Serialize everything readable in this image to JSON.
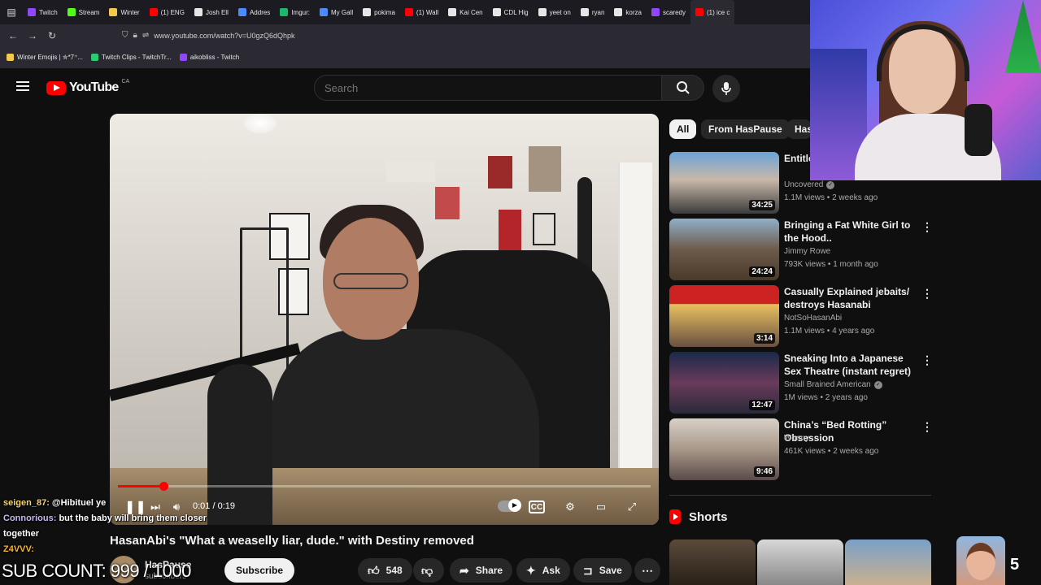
{
  "browser": {
    "tabs": [
      {
        "label": "Twitch",
        "color": "#9146ff",
        "active": false
      },
      {
        "label": "Stream",
        "color": "#53fc18",
        "active": false
      },
      {
        "label": "Winter",
        "color": "#f2c94c",
        "active": false
      },
      {
        "label": "(1) ENG",
        "color": "#ff0000",
        "active": false
      },
      {
        "label": "Josh Ell",
        "color": "#e6e6e6",
        "active": false
      },
      {
        "label": "Addres",
        "color": "#4a8cff",
        "active": false
      },
      {
        "label": "Imgur:",
        "color": "#1bb76e",
        "active": false
      },
      {
        "label": "My Gall",
        "color": "#4a8cff",
        "active": false
      },
      {
        "label": "pokima",
        "color": "#e6e6e6",
        "active": false
      },
      {
        "label": "(1) Wall",
        "color": "#ff0000",
        "active": false
      },
      {
        "label": "Kai Cen",
        "color": "#e6e6e6",
        "active": false
      },
      {
        "label": "CDL Hig",
        "color": "#e6e6e6",
        "active": false
      },
      {
        "label": "yeet on",
        "color": "#e6e6e6",
        "active": false
      },
      {
        "label": "ryan",
        "color": "#e6e6e6",
        "active": false
      },
      {
        "label": "korza",
        "color": "#e6e6e6",
        "active": false
      },
      {
        "label": "scaredy",
        "color": "#9146ff",
        "active": false
      },
      {
        "label": "(1) ice c",
        "color": "#ff0000",
        "active": true
      }
    ],
    "url": "www.youtube.com/watch?v=U0gzQ6dQhpk",
    "bookmarks": [
      {
        "label": "Winter Emojis | ✮*7⁺...",
        "color": "#f2c94c"
      },
      {
        "label": "Twitch Clips - TwitchTr...",
        "color": "#2ecc71"
      },
      {
        "label": "aikobliss - Twitch",
        "color": "#9146ff"
      }
    ]
  },
  "youtube": {
    "logo_text": "YouTube",
    "country": "CA",
    "search_placeholder": "Search",
    "video": {
      "title": "HasanAbi's \"What a weaselly liar, dude.\" with Destiny removed",
      "time": "0:01 / 0:19",
      "progress_fraction": 0.085
    },
    "channel": {
      "name": "HasPause",
      "subs": "subscribers"
    },
    "actions": {
      "subscribe": "Subscribe",
      "likes": "548",
      "share": "Share",
      "ask": "Ask",
      "save": "Save"
    },
    "chips": [
      "All",
      "From HasPause",
      "Has"
    ],
    "recommendations": [
      {
        "title": "Entitled ... Officer...",
        "channel": "Uncovered",
        "verified": true,
        "meta": "1.1M views • 2 weeks ago",
        "duration": "34:25"
      },
      {
        "title": "Bringing a Fat White Girl to the Hood..",
        "channel": "Jimmy Rowe",
        "verified": false,
        "meta": "793K views • 1 month ago",
        "duration": "24:24"
      },
      {
        "title": "Casually Explained jebaits/ destroys Hasanabi (Legendary...",
        "channel": "NotSoHasanAbi",
        "verified": false,
        "meta": "1.1M views • 4 years ago",
        "duration": "3:14"
      },
      {
        "title": "Sneaking Into a Japanese Sex Theatre  (instant regret)",
        "channel": "Small Brained American",
        "verified": true,
        "meta": "1M views • 2 years ago",
        "duration": "12:47"
      },
      {
        "title": "China’s “Bed Rotting” Obsession",
        "channel": "Wonny",
        "verified": false,
        "meta": "461K views • 2 weeks ago",
        "duration": "9:46"
      }
    ],
    "shorts_label": "Shorts"
  },
  "overlay": {
    "chat": [
      {
        "user": "seigen_87:",
        "text": " @Hibituel ye"
      },
      {
        "user": "Connorious:",
        "text": " but the baby will bring them closer together"
      },
      {
        "user": "Z4VVV:",
        "text": ""
      }
    ],
    "sub_count": "SUB COUNT: 999 / 1000",
    "viewer_count": "5"
  }
}
